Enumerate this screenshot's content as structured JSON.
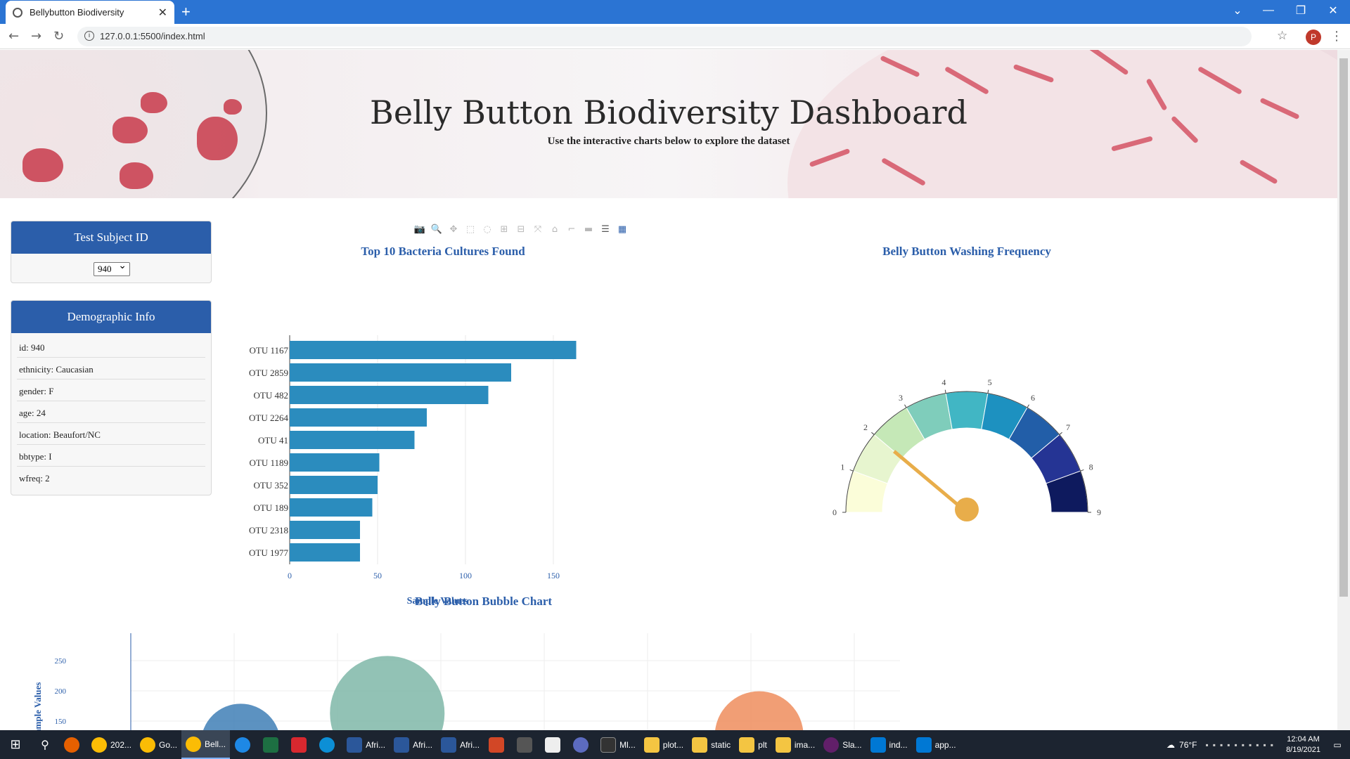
{
  "browser": {
    "tab_title": "Bellybutton Biodiversity",
    "new_tab": "+",
    "url": "127.0.0.1:5500/index.html",
    "profile_initial": "P"
  },
  "hero": {
    "title": "Belly Button Biodiversity Dashboard",
    "subtitle": "Use the interactive charts below to explore the dataset"
  },
  "subject_panel": {
    "header": "Test Subject ID",
    "selected": "940"
  },
  "demo_panel": {
    "header": "Demographic Info",
    "rows": [
      "id: 940",
      "ethnicity: Caucasian",
      "gender: F",
      "age: 24",
      "location: Beaufort/NC",
      "bbtype: I",
      "wfreq: 2"
    ]
  },
  "modebar": {
    "icons": [
      "camera-icon",
      "zoom-icon",
      "pan-icon",
      "box-select-icon",
      "lasso-icon",
      "zoom-in-icon",
      "zoom-out-icon",
      "autoscale-icon",
      "home-icon",
      "spike-icon",
      "hover-closest-icon",
      "hover-compare-icon",
      "plotly-logo-icon"
    ]
  },
  "chart_data": [
    {
      "type": "bar",
      "orientation": "horizontal",
      "title": "Top 10 Bacteria Cultures Found",
      "xlabel": "Sample Values",
      "categories": [
        "OTU 1167",
        "OTU 2859",
        "OTU 482",
        "OTU 2264",
        "OTU 41",
        "OTU 1189",
        "OTU 352",
        "OTU 189",
        "OTU 2318",
        "OTU 1977"
      ],
      "values": [
        163,
        126,
        113,
        78,
        71,
        51,
        50,
        47,
        40,
        40
      ],
      "xlim": [
        0,
        168
      ],
      "xticks": [
        "0",
        "50",
        "100",
        "150"
      ],
      "color": "#2b8cbe"
    },
    {
      "type": "gauge",
      "title": "Belly Button Washing Frequency",
      "range": [
        0,
        9
      ],
      "value": 2,
      "ticks": [
        "0",
        "1",
        "2",
        "3",
        "4",
        "5",
        "6",
        "7",
        "8",
        "9"
      ],
      "band_colors": [
        "#fbfdd9",
        "#e7f5cf",
        "#c5e8b7",
        "#7fcdbb",
        "#41b6c4",
        "#1d91c0",
        "#225ea8",
        "#253494",
        "#0e1a5e"
      ],
      "needle_color": "#e8ad4a"
    },
    {
      "type": "scatter",
      "title": "Belly Button Bubble Chart",
      "ylabel": "Sample Values",
      "yticks": [
        "150",
        "200",
        "250"
      ],
      "points": [
        {
          "x": 500,
          "y": 113,
          "size": 113,
          "color": "#3f7fb6"
        },
        {
          "x": 1167,
          "y": 163,
          "size": 163,
          "color": "#7fb7a8"
        },
        {
          "x": 2859,
          "y": 126,
          "size": 126,
          "color": "#ef8d5d"
        }
      ]
    }
  ],
  "taskbar": {
    "items": [
      "202...",
      "Go...",
      "Bell...",
      "Afri...",
      "Afri...",
      "Afri...",
      "Ml...",
      "plot...",
      "static",
      "plt",
      "ima...",
      "Sla...",
      "ind...",
      "app..."
    ],
    "weather": "76°F",
    "time": "12:04 AM",
    "date": "8/19/2021"
  }
}
